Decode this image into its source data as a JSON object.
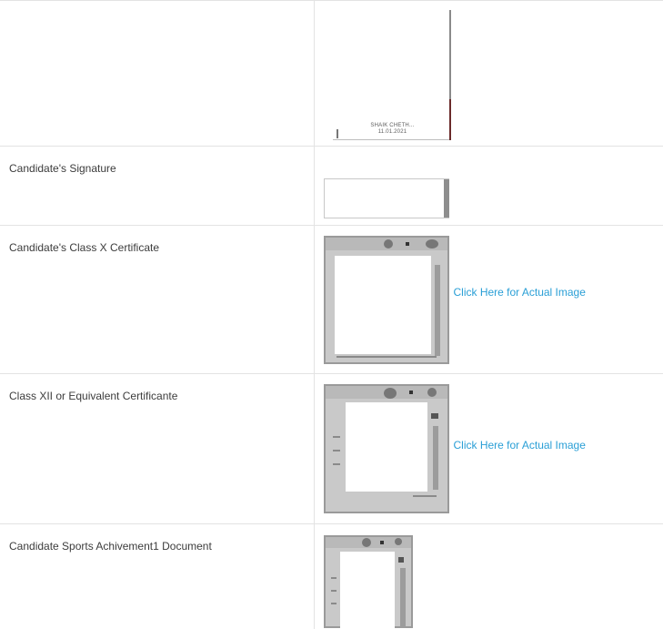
{
  "rows": [
    {
      "label": "",
      "image": "photo"
    },
    {
      "label": "Candidate's Signature",
      "image": "signature"
    },
    {
      "label": "Candidate's Class X Certificate",
      "image": "certificate",
      "link": "Click Here for Actual Image"
    },
    {
      "label": "Class XII or Equivalent Certificante",
      "image": "certificate",
      "link": "Click Here for Actual Image"
    },
    {
      "label": "Candidate Sports Achivement1 Document",
      "image": "certificate"
    }
  ],
  "photo_stamp": {
    "line1": "SHAIK CHETH...",
    "line2": "11.01.2021"
  }
}
